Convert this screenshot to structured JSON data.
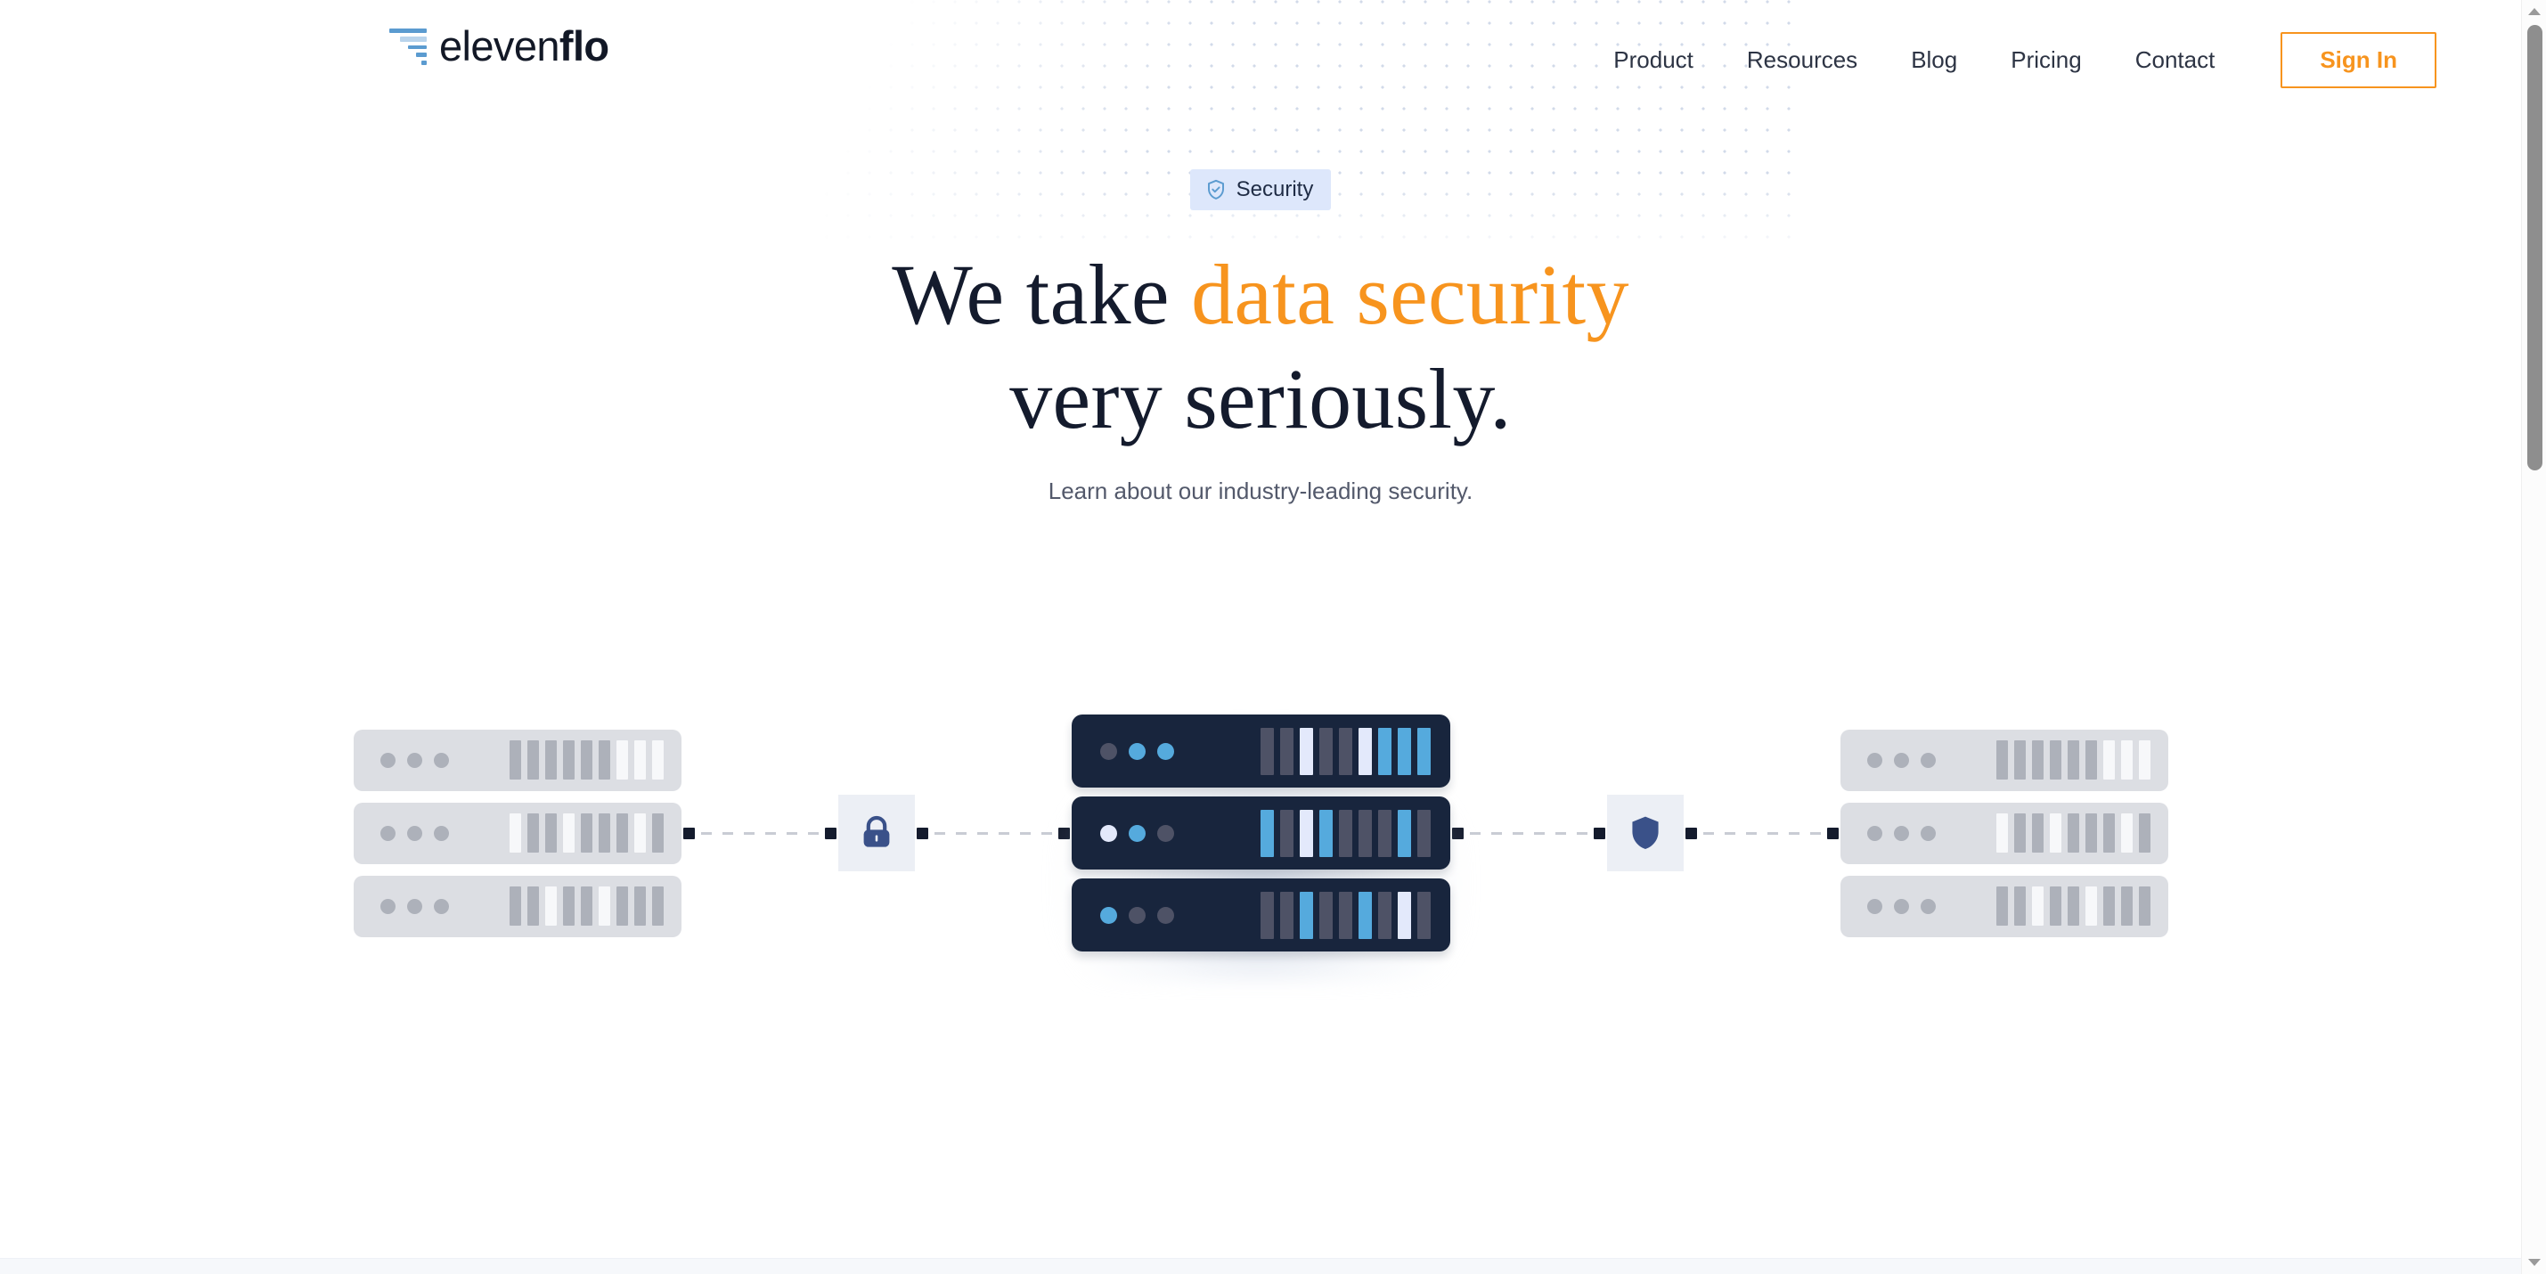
{
  "brand": {
    "name_light": "eleven",
    "name_bold": "flo",
    "logo_icon": "funnel-bars-logo"
  },
  "nav": {
    "links": [
      {
        "label": "Product"
      },
      {
        "label": "Resources"
      },
      {
        "label": "Blog"
      },
      {
        "label": "Pricing"
      },
      {
        "label": "Contact"
      }
    ],
    "signin_label": "Sign In"
  },
  "hero": {
    "badge": {
      "label": "Security",
      "icon": "shield-check-icon"
    },
    "headline_line1_plain": "We take ",
    "headline_line1_accent": "data security",
    "headline_line2": "very seriously.",
    "subhead": "Learn about our industry-leading security."
  },
  "illustration": {
    "lock_icon": "padlock-icon",
    "shield_icon": "shield-icon",
    "left_rack": {
      "rows": [
        {
          "leds": [
            "g",
            "g",
            "g"
          ],
          "bars": [
            "g",
            "g",
            "g",
            "g",
            "g",
            "g",
            "w",
            "w",
            "w"
          ]
        },
        {
          "leds": [
            "g",
            "g",
            "g"
          ],
          "bars": [
            "w",
            "g",
            "g",
            "w",
            "g",
            "g",
            "g",
            "w",
            "g"
          ]
        },
        {
          "leds": [
            "g",
            "g",
            "g"
          ],
          "bars": [
            "g",
            "g",
            "w",
            "g",
            "g",
            "w",
            "g",
            "g",
            "g"
          ]
        }
      ]
    },
    "center_rack": {
      "rows": [
        {
          "leds": [
            "dark",
            "blue",
            "blue"
          ],
          "bars": [
            "dark",
            "dark",
            "white",
            "dark",
            "dark",
            "white",
            "blue",
            "blue",
            "blue"
          ]
        },
        {
          "leds": [
            "white",
            "blue",
            "dark"
          ],
          "bars": [
            "blue",
            "dark",
            "white",
            "blue",
            "dark",
            "dark",
            "dark",
            "blue",
            "dark"
          ]
        },
        {
          "leds": [
            "blue",
            "dark",
            "dark"
          ],
          "bars": [
            "dark",
            "dark",
            "blue",
            "dark",
            "dark",
            "blue",
            "dark",
            "white",
            "dark"
          ]
        }
      ]
    },
    "right_rack": {
      "rows": [
        {
          "leds": [
            "g",
            "g",
            "g"
          ],
          "bars": [
            "g",
            "g",
            "g",
            "g",
            "g",
            "g",
            "w",
            "w",
            "w"
          ]
        },
        {
          "leds": [
            "g",
            "g",
            "g"
          ],
          "bars": [
            "w",
            "g",
            "g",
            "w",
            "g",
            "g",
            "g",
            "w",
            "g"
          ]
        },
        {
          "leds": [
            "g",
            "g",
            "g"
          ],
          "bars": [
            "g",
            "g",
            "w",
            "g",
            "g",
            "w",
            "g",
            "g",
            "g"
          ]
        }
      ]
    }
  },
  "colors": {
    "accent_orange": "#f7941e",
    "brand_navy": "#141b2d",
    "logo_blue": "#5b9bd0",
    "badge_bg": "#dde7fb",
    "server_dark": "#18253d",
    "led_blue": "#55aadd",
    "led_white": "#e3e9fb",
    "led_slate": "#4e5266",
    "rack_gray": "#dcdee3",
    "tile_bg": "#eceff5",
    "icon_navy": "#3a5189"
  }
}
